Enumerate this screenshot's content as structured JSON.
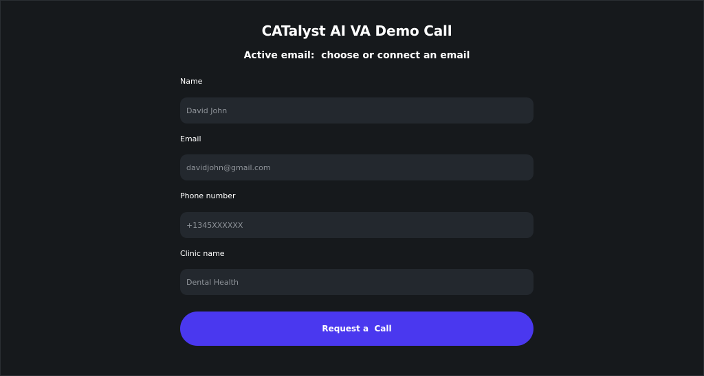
{
  "page": {
    "title": "CATalyst AI VA Demo Call",
    "active_email": "Active email:  choose or connect an email"
  },
  "form": {
    "name": {
      "label": "Name",
      "placeholder": "David John",
      "value": ""
    },
    "email": {
      "label": "Email",
      "placeholder": "davidjohn@gmail.com",
      "value": ""
    },
    "phone": {
      "label": "Phone number",
      "placeholder": "+1345XXXXXX",
      "value": ""
    },
    "clinic": {
      "label": "Clinic name",
      "placeholder": "Dental Health",
      "value": ""
    },
    "submit_label": "Request a  Call"
  },
  "colors": {
    "background": "#16191c",
    "input_background": "#23282e",
    "accent": "#4a38ef",
    "text": "#ffffff",
    "placeholder": "#8f949a"
  }
}
